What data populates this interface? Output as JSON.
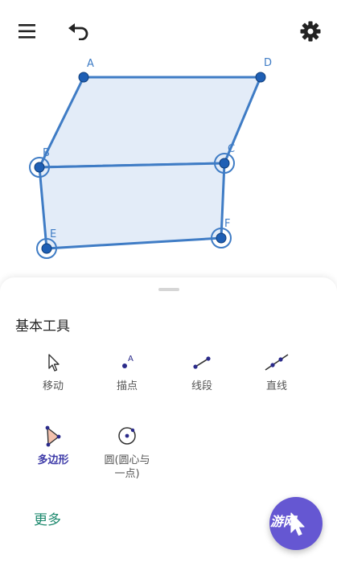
{
  "toolbar": {
    "menu_icon": "menu-icon",
    "undo_icon": "undo-icon",
    "settings_icon": "settings-icon"
  },
  "graphics": {
    "points": [
      {
        "label": "A"
      },
      {
        "label": "D"
      },
      {
        "label": "B"
      },
      {
        "label": "C"
      },
      {
        "label": "E"
      },
      {
        "label": "F"
      }
    ],
    "colors": {
      "polygon_fill": "#e3ecf8",
      "stroke": "#3f7cc5",
      "point": "#1f5fb4"
    }
  },
  "panel": {
    "title": "基本工具",
    "tools": [
      {
        "label": "移动",
        "icon": "move-pointer-icon"
      },
      {
        "label": "描点",
        "icon": "point-icon"
      },
      {
        "label": "线段",
        "icon": "segment-icon"
      },
      {
        "label": "直线",
        "icon": "line-icon"
      },
      {
        "label": "多边形",
        "icon": "polygon-icon",
        "active": true
      },
      {
        "label": "圆(圆心与一点)",
        "icon": "circle-center-point-icon"
      }
    ],
    "more_label": "更多"
  },
  "fab": {
    "icon": "pointer-icon",
    "color": "#6557d2"
  },
  "watermark": "游网"
}
